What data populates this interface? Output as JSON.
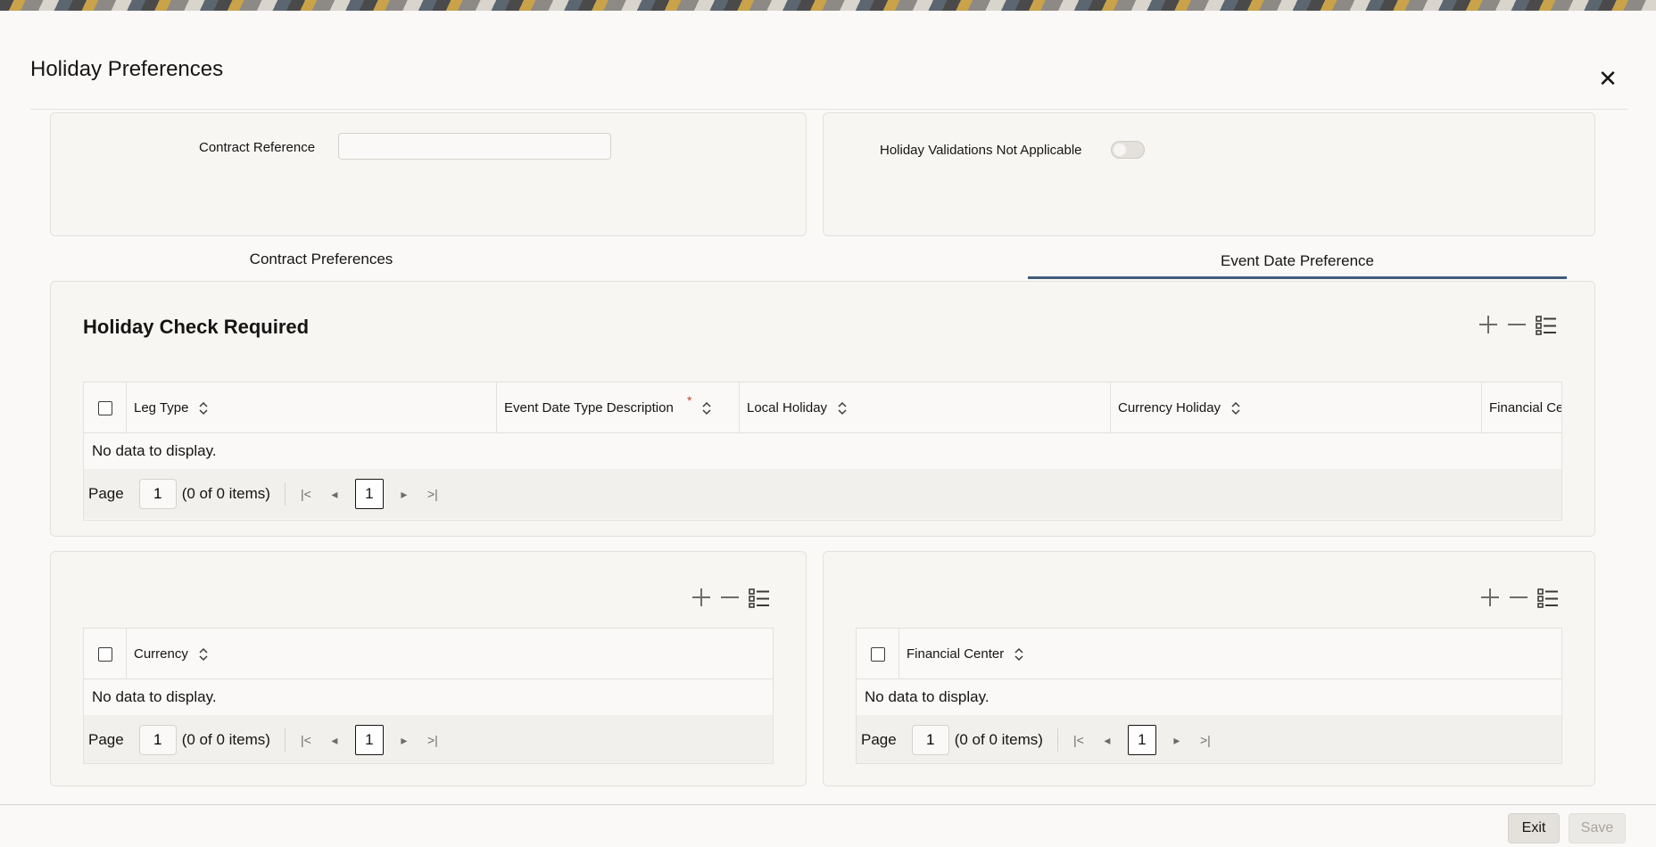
{
  "dialog": {
    "title": "Holiday Preferences",
    "close_icon": "close-icon"
  },
  "header_panel": {
    "contract_reference_label": "Contract Reference",
    "contract_reference_value": "",
    "holiday_validations_label": "Holiday Validations Not Applicable",
    "holiday_validations_on": false
  },
  "tabs": [
    {
      "label": "Contract Preferences",
      "selected": false
    },
    {
      "label": "Event Date Preference",
      "selected": true
    }
  ],
  "holiday_check": {
    "title": "Holiday Check Required",
    "columns": [
      "Leg Type",
      "Event Date Type Description",
      "Local Holiday",
      "Currency Holiday",
      "Financial Ce"
    ],
    "no_data": "No data to display.",
    "pager": {
      "page_label": "Page",
      "page_value": "1",
      "count": "(0 of 0 items)",
      "current": "1"
    }
  },
  "currency_grid": {
    "columns": [
      "Currency"
    ],
    "no_data": "No data to display.",
    "pager": {
      "page_label": "Page",
      "page_value": "1",
      "count": "(0 of 0 items)",
      "current": "1"
    }
  },
  "financial_center_grid": {
    "columns": [
      "Financial Center"
    ],
    "no_data": "No data to display.",
    "pager": {
      "page_label": "Page",
      "page_value": "1",
      "count": "(0 of 0 items)",
      "current": "1"
    }
  },
  "footer": {
    "exit_label": "Exit",
    "save_label": "Save"
  },
  "colors": {
    "tab_underline": "#3f5c7a",
    "required": "#c74634"
  }
}
